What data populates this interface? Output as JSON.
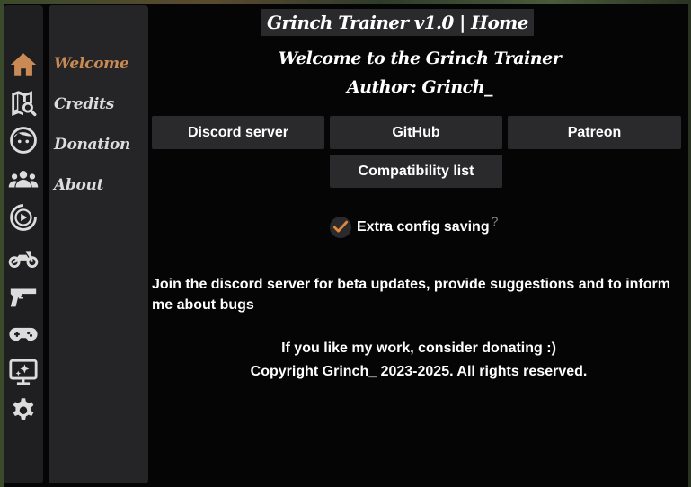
{
  "window": {
    "title": "Grinch Trainer v1.0 | Home"
  },
  "icon_rail": [
    {
      "name": "home-icon",
      "active": true
    },
    {
      "name": "map-search-icon"
    },
    {
      "name": "face-icon"
    },
    {
      "name": "group-icon"
    },
    {
      "name": "play-circle-icon"
    },
    {
      "name": "motorcycle-icon"
    },
    {
      "name": "pistol-icon"
    },
    {
      "name": "gamepad-icon"
    },
    {
      "name": "monitor-sparkle-icon"
    },
    {
      "name": "gear-icon"
    }
  ],
  "nav": {
    "items": [
      {
        "label": "Welcome",
        "active": true
      },
      {
        "label": "Credits"
      },
      {
        "label": "Donation"
      },
      {
        "label": "About"
      }
    ]
  },
  "main": {
    "welcome_line": "Welcome to the Grinch Trainer",
    "author_line": "Author: Grinch_",
    "buttons": {
      "discord": "Discord server",
      "github": "GitHub",
      "patreon": "Patreon",
      "compatibility": "Compatibility list"
    },
    "option": {
      "label": "Extra config saving",
      "checked": true,
      "help": "?"
    },
    "info_text": "Join the discord server for beta updates, provide suggestions and to inform me about bugs",
    "donate_text": "If you like my work, consider donating :)",
    "copyright": "Copyright Grinch_ 2023-2025. All rights reserved."
  },
  "colors": {
    "accent": "#c98a55",
    "panel": "#252527",
    "rail": "#1f1f21",
    "button": "#2a2a2d",
    "background": "#050505"
  }
}
